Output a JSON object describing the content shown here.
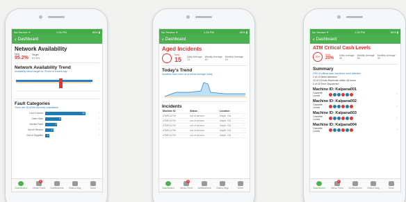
{
  "status_bar": {
    "carrier": "No Service ✈",
    "time": "1:26 PM",
    "battery": "85% ▮"
  },
  "phone1": {
    "nav_back": "Dashboard",
    "title": "Network Availability",
    "now_label": "Now",
    "now_value": "95.2%",
    "target_label": "Target",
    "target_value": "97.5%",
    "trend_title": "Network Availability Trend",
    "trend_subtitle": "Availability below target for 75 min of current day",
    "fault_title": "Fault Categories",
    "fault_subtitle": "There are 16 ATMs currently unavailable",
    "fault_rows": [
      {
        "label": "Lost Comms",
        "value": "10"
      },
      {
        "label": "Cash Outs",
        "value": "4"
      },
      {
        "label": "Device Fault",
        "value": "3"
      },
      {
        "label": "Out of Service",
        "value": "2"
      },
      {
        "label": "Out of Supplies",
        "value": "1"
      }
    ],
    "fault_values_num": [
      10,
      4,
      3,
      2,
      1
    ]
  },
  "phone2": {
    "nav_back": "Dashboard",
    "title": "Aged Incidents",
    "now_label": "Now",
    "now_value": "15",
    "stats": [
      {
        "label": "Daily Average",
        "value": "13"
      },
      {
        "label": "Weekly Average",
        "value": "15"
      },
      {
        "label": "Monthly Average",
        "value": "15"
      }
    ],
    "trend_title": "Today's Trend",
    "trend_subtitle": "Incidents have been at or below average today",
    "incidents_title": "Incidents",
    "columns": [
      "Machine ID",
      "Status",
      "Location"
    ],
    "rows": [
      [
        "ATM014709",
        "out of service",
        "Dayth, GA"
      ],
      [
        "ATM014709",
        "out of service",
        "Dayth, GA"
      ],
      [
        "ATM014709",
        "out of service",
        "Dayth, GA"
      ],
      [
        "ATM014709",
        "out of service",
        "Dayth, GA"
      ],
      [
        "ATM014709",
        "out of service",
        "Dayth, GA"
      ]
    ]
  },
  "phone3": {
    "nav_back": "Dashboard",
    "title": "ATM Critical Cash Levels",
    "now_label": "Now",
    "now_value": "20%",
    "stats": [
      {
        "label": "Daily Average",
        "value": "30"
      },
      {
        "label": "Weekly Average",
        "value": "33"
      },
      {
        "label": "Monthly Average",
        "value": "33"
      }
    ],
    "summary_title": "Summary",
    "summary_lines": [
      "20% of critical cash machines need attention",
      "2 of 15  Need Attention",
      "10 of 15 Auto-Replenish within 48 hours",
      "3 of 15  Tech Dispatched"
    ],
    "machines": [
      {
        "name": "Machine ID: Kalpana001",
        "label": "Cassette Levels"
      },
      {
        "name": "Machine ID: Kalpana002",
        "label": "Cassette Levels"
      },
      {
        "name": "Machine ID: Kalpana003",
        "label": "Cassette Levels"
      },
      {
        "name": "Machine ID: Kalpana004",
        "label": "Cassette Levels"
      }
    ]
  },
  "tabs": [
    {
      "label": "Dashboard"
    },
    {
      "label": "News Feed",
      "badge": "2"
    },
    {
      "label": "Notifications"
    },
    {
      "label": "Status Map"
    },
    {
      "label": "More"
    }
  ],
  "colors": {
    "green": "#4caf50",
    "red": "#e3342f",
    "blue": "#1f7ab8"
  }
}
